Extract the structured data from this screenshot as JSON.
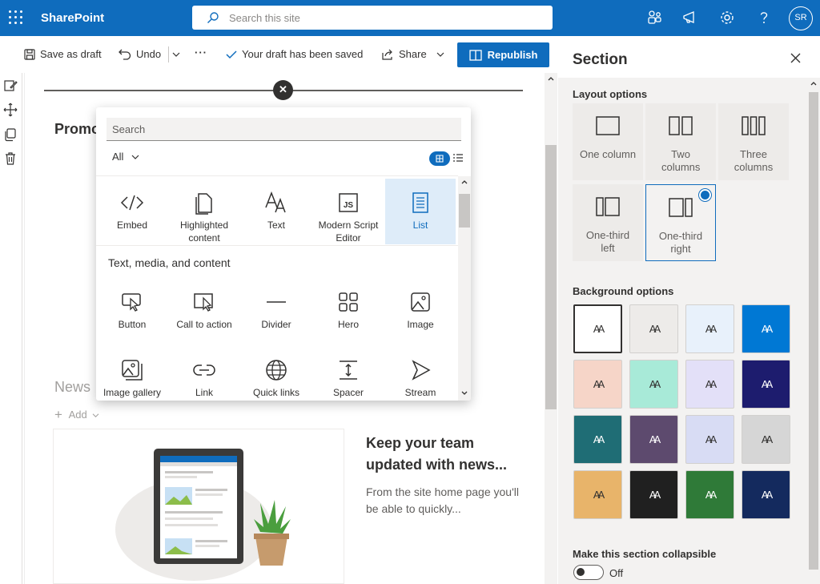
{
  "topbar": {
    "brand": "SharePoint",
    "search_placeholder": "Search this site",
    "avatar_initials": "SR",
    "icons": [
      "app-launcher-icon",
      "teams-icon",
      "megaphone-icon",
      "gear-icon",
      "help-icon"
    ]
  },
  "commandbar": {
    "save_draft": "Save as draft",
    "undo": "Undo",
    "more": "···",
    "status": "Your draft has been saved",
    "share": "Share",
    "republish": "Republish"
  },
  "canvas": {
    "promo_heading": "Promo",
    "news_heading": "News",
    "add_label": "Add",
    "news_title": "Keep your team updated with news...",
    "news_body": "From the site home page you'll be able to quickly..."
  },
  "picker": {
    "search_placeholder": "Search",
    "filter": "All",
    "section_heading": "Text, media, and content",
    "top_row": [
      {
        "label": "Embed",
        "icon": "embed-icon"
      },
      {
        "label": "Highlighted content",
        "icon": "highlighted-content-icon"
      },
      {
        "label": "Text",
        "icon": "text-icon"
      },
      {
        "label": "Modern Script Editor",
        "icon": "script-editor-icon"
      },
      {
        "label": "List",
        "icon": "list-icon",
        "selected": true
      }
    ],
    "row2": [
      {
        "label": "Button",
        "icon": "button-icon"
      },
      {
        "label": "Call to action",
        "icon": "call-to-action-icon"
      },
      {
        "label": "Divider",
        "icon": "divider-icon"
      },
      {
        "label": "Hero",
        "icon": "hero-icon"
      },
      {
        "label": "Image",
        "icon": "image-icon"
      }
    ],
    "row3": [
      {
        "label": "Image gallery",
        "icon": "image-gallery-icon"
      },
      {
        "label": "Link",
        "icon": "link-icon"
      },
      {
        "label": "Quick links",
        "icon": "globe-icon"
      },
      {
        "label": "Spacer",
        "icon": "spacer-icon"
      },
      {
        "label": "Stream",
        "icon": "stream-icon"
      }
    ]
  },
  "panel": {
    "title": "Section",
    "layout_label": "Layout options",
    "layouts": [
      {
        "label": "One column"
      },
      {
        "label": "Two columns"
      },
      {
        "label": "Three columns"
      },
      {
        "label": "One-third left"
      },
      {
        "label": "One-third right",
        "selected": true
      }
    ],
    "background_label": "Background options",
    "tile_glyph": "AA",
    "backgrounds": [
      {
        "color": "#ffffff",
        "selected": true
      },
      {
        "color": "#edebe9"
      },
      {
        "color": "#e8f1fb"
      },
      {
        "color": "#0078d4"
      },
      {
        "color": "#f6d5c8"
      },
      {
        "color": "#a8ead8"
      },
      {
        "color": "#e3e0f8"
      },
      {
        "color": "#1d1c6e"
      },
      {
        "color": "#1f6d75"
      },
      {
        "color": "#5d4a6e"
      },
      {
        "color": "#d8dcf4"
      },
      {
        "color": "#d6d6d6"
      },
      {
        "color": "#e8b46a"
      },
      {
        "color": "#202020"
      },
      {
        "color": "#2f7a38"
      },
      {
        "color": "#142a5e"
      }
    ],
    "collapsible_label": "Make this section collapsible",
    "toggle_state": "Off"
  }
}
